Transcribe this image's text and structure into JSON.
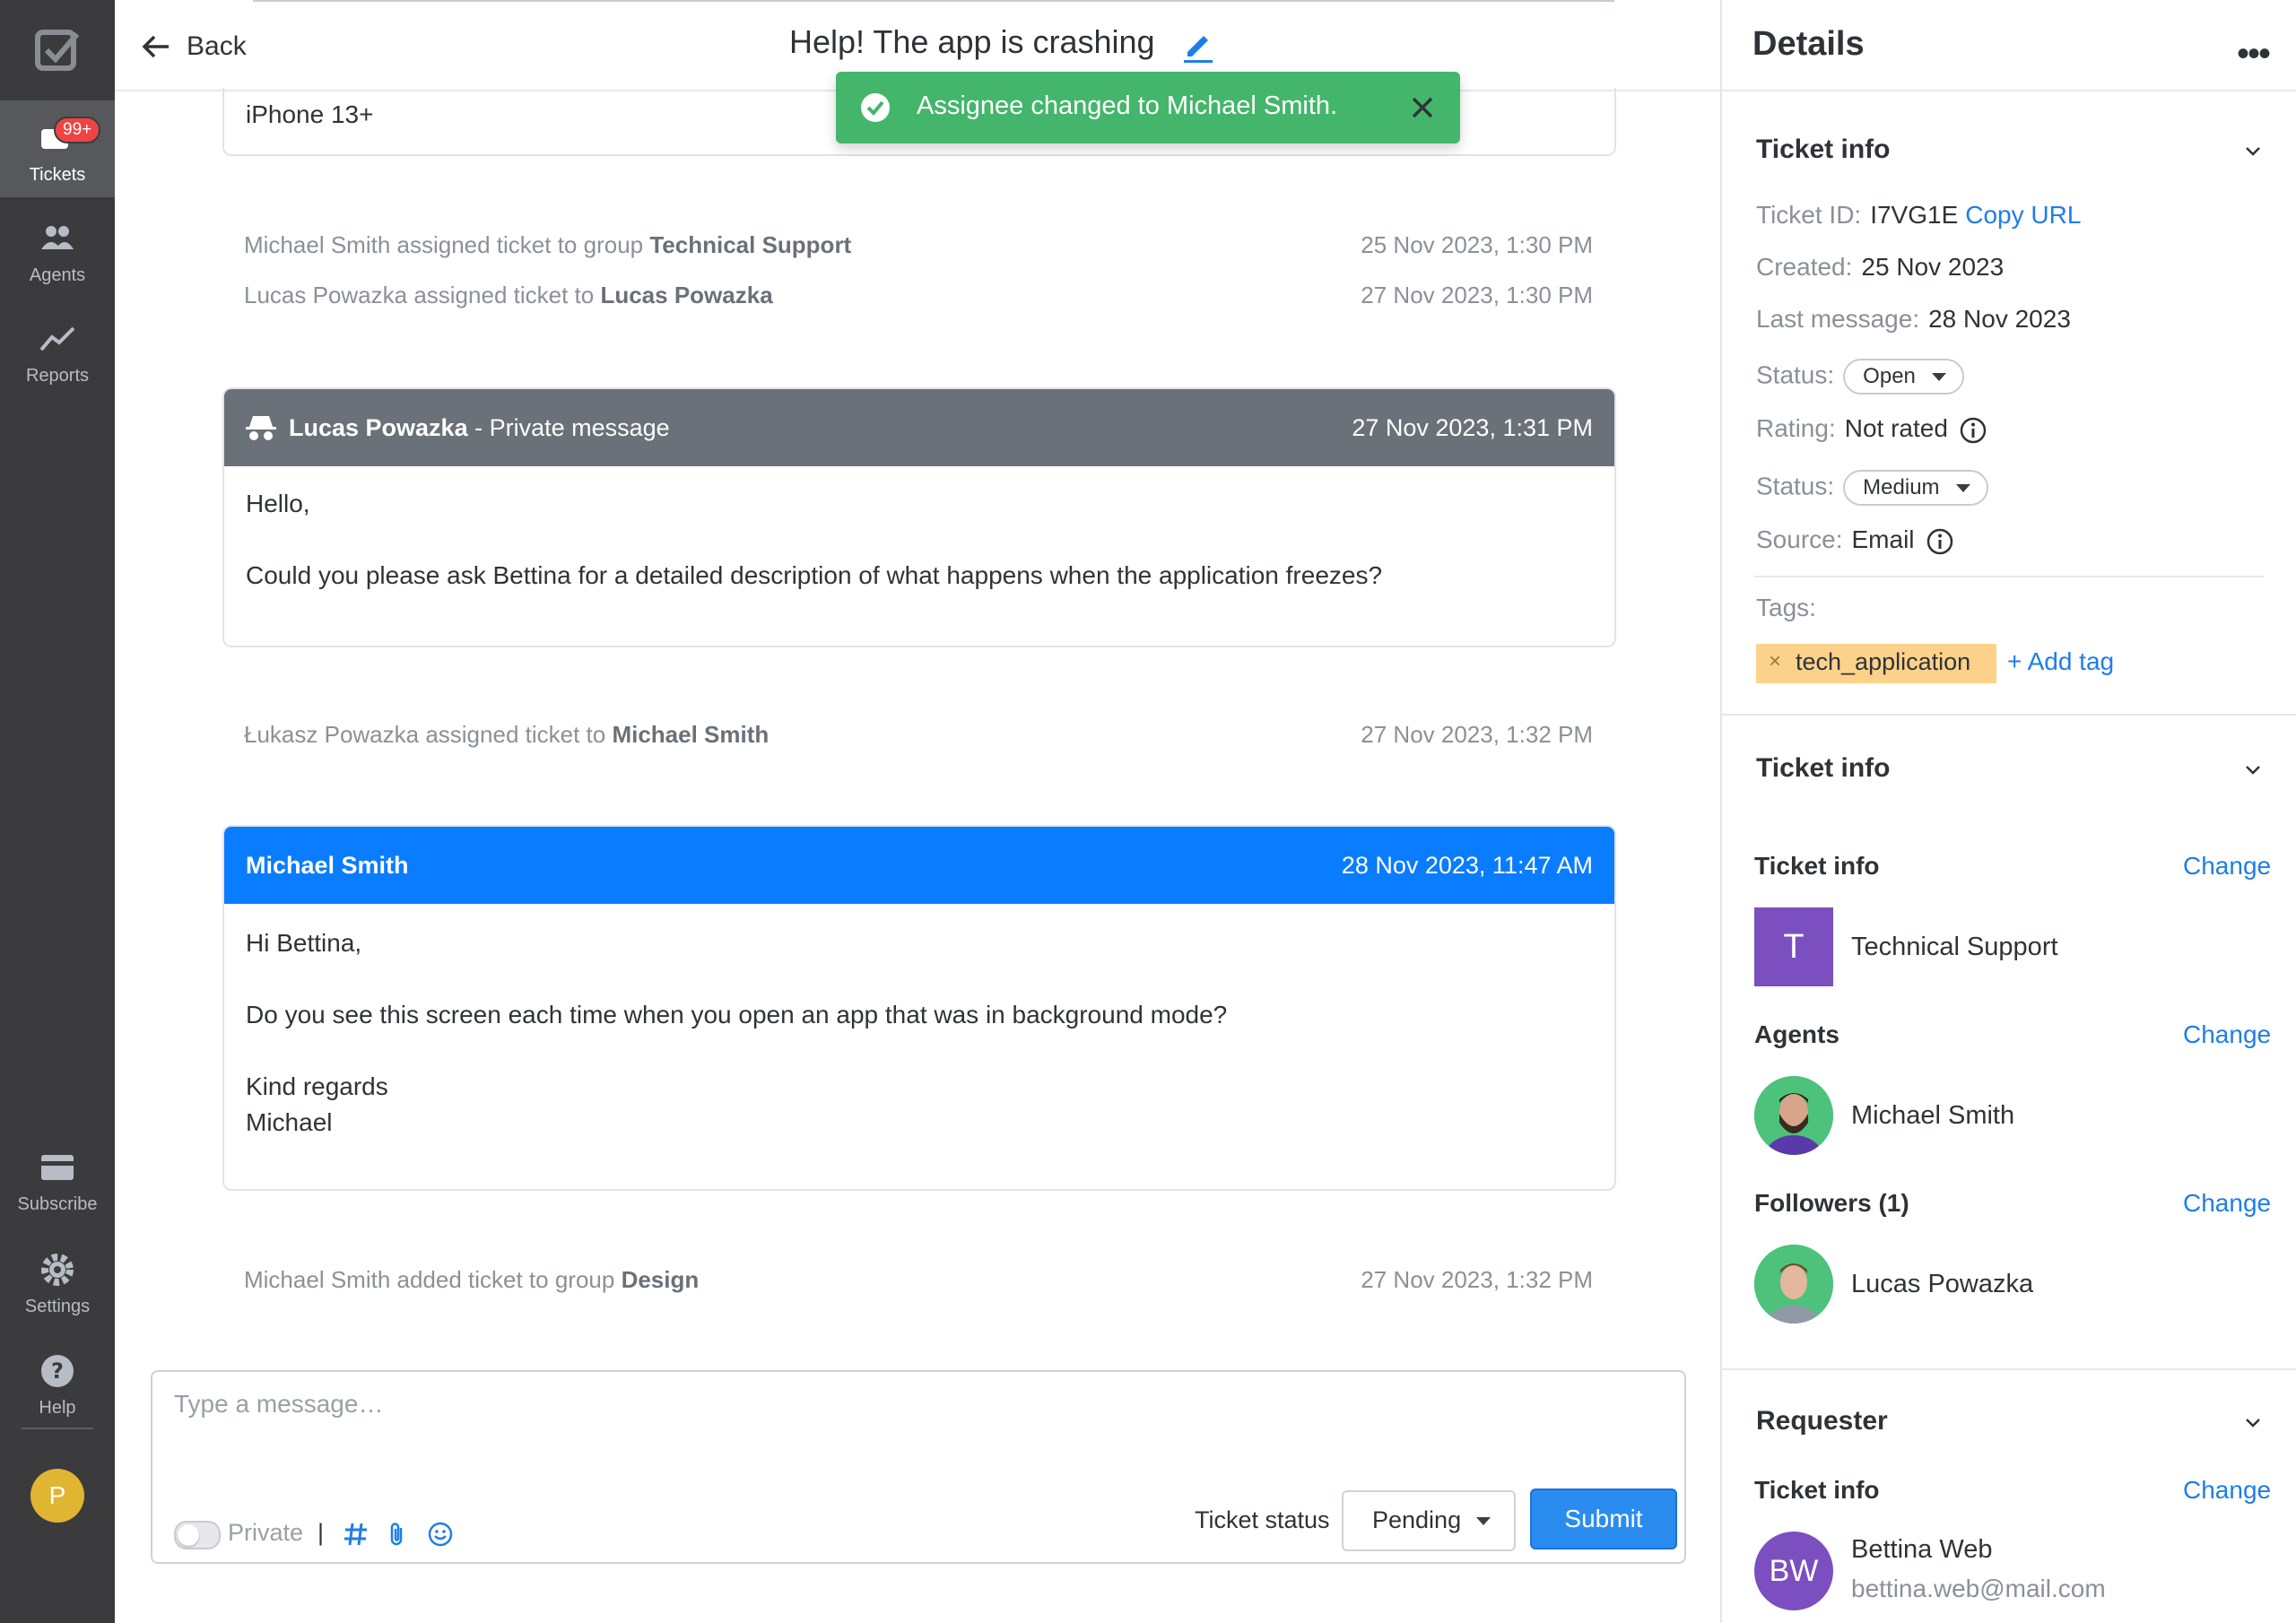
{
  "sidebar": {
    "items": [
      {
        "label": "Tickets",
        "icon": "ticket-icon",
        "badge": "99+"
      },
      {
        "label": "Agents",
        "icon": "agents-icon"
      },
      {
        "label": "Reports",
        "icon": "reports-icon"
      }
    ],
    "bottom": [
      {
        "label": "Subscribe",
        "icon": "card-icon"
      },
      {
        "label": "Settings",
        "icon": "gear-icon"
      },
      {
        "label": "Help",
        "icon": "help-icon"
      }
    ],
    "user_initial": "P"
  },
  "header": {
    "back_label": "Back",
    "title": "Help! The app is crashing"
  },
  "toast": {
    "message": "Assignee changed to Michael Smith."
  },
  "thread": {
    "device_text": "iPhone 13+",
    "events": [
      {
        "prefix": "Michael Smith assigned ticket to group ",
        "strong": "Technical Support",
        "time": "25 Nov 2023, 1:30 PM"
      },
      {
        "prefix": "Lucas Powazka assigned ticket to ",
        "strong": "Lucas Powazka",
        "time": "27 Nov 2023, 1:30 PM"
      },
      {
        "prefix": "Łukasz Powazka assigned ticket to ",
        "strong": "Michael Smith",
        "time": "27 Nov 2023, 1:32 PM"
      },
      {
        "prefix": "Michael Smith added ticket to group ",
        "strong": "Design",
        "time": "27 Nov 2023, 1:32 PM"
      }
    ],
    "private_message": {
      "author": "Lucas Powazka",
      "suffix": " - Private message",
      "time": "27 Nov 2023, 1:31 PM",
      "lines": [
        "Hello,",
        "Could you please ask Bettina for a detailed description of what happens when the application freezes?"
      ]
    },
    "reply": {
      "author": "Michael Smith",
      "time": "28 Nov 2023, 11:47 AM",
      "lines": [
        "Hi Bettina,",
        "Do you see this screen each time when you open an app that was in background mode?",
        "Kind regards",
        "Michael"
      ]
    }
  },
  "composer": {
    "placeholder": "Type a message…",
    "private_label": "Private",
    "separator": "|",
    "status_label": "Ticket status",
    "status_value": "Pending",
    "submit_label": "Submit"
  },
  "details": {
    "title": "Details",
    "more": "•••",
    "ticket_info": {
      "heading": "Ticket info",
      "id_label": "Ticket ID:",
      "id_value": "I7VG1E",
      "copy_url": "Copy URL",
      "created_label": "Created:",
      "created_value": "25 Nov 2023",
      "last_label": "Last message:",
      "last_value": "28 Nov 2023",
      "status_label": "Status:",
      "status_value": "Open",
      "rating_label": "Rating:",
      "rating_value": "Not rated",
      "priority_label": "Status:",
      "priority_value": "Medium",
      "source_label": "Source:",
      "source_value": "Email",
      "tags_label": "Tags:",
      "tag": "tech_application",
      "tag_remove": "×",
      "add_tag": "+ Add tag"
    },
    "assignment": {
      "heading": "Ticket info",
      "group_heading": "Ticket info",
      "change": "Change",
      "group_initial": "T",
      "group_name": "Technical Support",
      "agents_heading": "Agents",
      "agent_name": "Michael Smith",
      "followers_heading": "Followers (1)",
      "follower_name": "Lucas Powazka"
    },
    "requester": {
      "heading": "Requester",
      "sub_heading": "Ticket info",
      "change": "Change",
      "initials": "BW",
      "name": "Bettina Web",
      "email": "bettina.web@mail.com"
    }
  },
  "colors": {
    "sidebar": "#3b3b3d",
    "toast": "#43b66b",
    "private_header": "#6b7178",
    "reply_header": "#0a7cff",
    "link": "#1e7ee8",
    "tag": "#fcd28a",
    "purple": "#7b4fbf"
  }
}
